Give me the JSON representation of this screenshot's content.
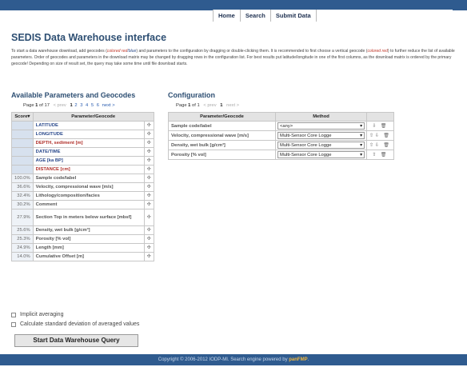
{
  "menu": [
    "Home",
    "Search",
    "Submit Data"
  ],
  "title": "SEDIS Data Warehouse interface",
  "intro": {
    "p1": "To start a data warehouse download, add geocodes (",
    "red1": "colored red",
    "slash": "/",
    "blue1": "blue",
    "p2": ") and parameters to the configuration by dragging or double-clicking them. It is recommended to first choose a vertical geocode (",
    "red2": "colored red",
    "p3": ") to further reduce the list of available parameters. Order of geocodes and parameters in the download matrix may be changed by dragging rows in the configuration list. For best results put latitude/longitude in one of the first columns, as the download matrix is ordered by the primary geocode! Depending on size of result set, the query may take some time until file download starts."
  },
  "available": {
    "heading": "Available Parameters and Geocodes",
    "pager": {
      "page": "Page",
      "cur": "1",
      "of": "of 17",
      "prev": "< prev",
      "pages": [
        "1",
        "2",
        "3",
        "4",
        "5",
        "6"
      ],
      "next": "next >"
    },
    "col_score": "Score▾",
    "col_param": "Parameter/Geocode",
    "rows": [
      {
        "score": "",
        "name": "LATITUDE",
        "kind": "geo blue",
        "tall": false
      },
      {
        "score": "",
        "name": "LONGITUDE",
        "kind": "geo blue",
        "tall": false
      },
      {
        "score": "",
        "name": "DEPTH, sediment [m]",
        "kind": "geo red",
        "tall": false
      },
      {
        "score": "",
        "name": "DATE/TIME",
        "kind": "geo blue",
        "tall": false
      },
      {
        "score": "",
        "name": "AGE [ka BP]",
        "kind": "geo blue",
        "tall": false
      },
      {
        "score": "",
        "name": "DISTANCE [cm]",
        "kind": "geo red",
        "tall": false
      },
      {
        "score": "100.0%",
        "name": "Sample code/label",
        "kind": "param",
        "tall": false
      },
      {
        "score": "36.6%",
        "name": "Velocity, compressional wave [m/s]",
        "kind": "param",
        "tall": false
      },
      {
        "score": "32.4%",
        "name": "Lithology/composition/facies",
        "kind": "param",
        "tall": false
      },
      {
        "score": "30.2%",
        "name": "Comment",
        "kind": "param",
        "tall": false
      },
      {
        "score": "27.9%",
        "name": "Section Top in meters below surface [mbsf]",
        "kind": "param",
        "tall": true
      },
      {
        "score": "25.6%",
        "name": "Density, wet bulk [g/cm³]",
        "kind": "param",
        "tall": false
      },
      {
        "score": "25.3%",
        "name": "Porosity [% vol]",
        "kind": "param",
        "tall": false
      },
      {
        "score": "24.9%",
        "name": "Length [mm]",
        "kind": "param",
        "tall": false
      },
      {
        "score": "14.0%",
        "name": "Cumulative Offset [m]",
        "kind": "param",
        "tall": false
      }
    ]
  },
  "configuration": {
    "heading": "Configuration",
    "pager": {
      "page": "Page",
      "cur": "1",
      "of": "of 1",
      "prev": "< prev",
      "next": "next >"
    },
    "col_param": "Parameter/Geocode",
    "col_method": "Method",
    "rows": [
      {
        "name": "Sample code/label",
        "method": "<any>",
        "ops": "⇩ 🗑"
      },
      {
        "name": "Velocity, compressional wave [m/s]",
        "method": "Multi-Sensor Core Logge",
        "ops": "⇧⇩ 🗑"
      },
      {
        "name": "Density, wet bulk [g/cm³]",
        "method": "Multi-Sensor Core Logge",
        "ops": "⇧⇩ 🗑"
      },
      {
        "name": "Porosity [% vol]",
        "method": "Multi-Sensor Core Logge",
        "ops": "⇧ 🗑"
      }
    ]
  },
  "options": {
    "implicit": "Implicit averaging",
    "stddev": "Calculate standard deviation of averaged values"
  },
  "start_button": "Start Data Warehouse Query",
  "footer": {
    "text": "Copyright © 2006-2012 IODP-MI. Search engine powered by ",
    "brand": "panFMP",
    "end": "."
  },
  "colors": {
    "bar": "#2f5b8f",
    "title": "#2e4f73",
    "geocode_blue": "#2b4a8c",
    "geocode_red": "#b0302a"
  }
}
